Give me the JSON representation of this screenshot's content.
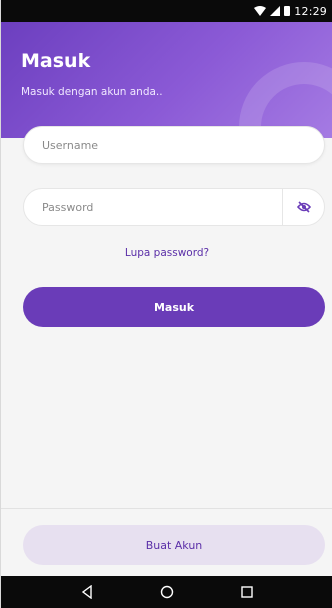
{
  "status_bar": {
    "time": "12:29",
    "icons": [
      "wifi-icon",
      "signal-icon",
      "battery-icon"
    ]
  },
  "header": {
    "title": "Masuk",
    "subtitle": "Masuk dengan akun anda.."
  },
  "form": {
    "username_placeholder": "Username",
    "password_placeholder": "Password",
    "toggle_visibility_icon": "eye-slash-icon",
    "forgot_password": "Lupa password?",
    "submit_label": "Masuk"
  },
  "footer": {
    "create_account_label": "Buat Akun"
  },
  "nav": {
    "icons": [
      "back-icon",
      "home-icon",
      "recents-icon"
    ]
  },
  "colors": {
    "primary": "#6a3cb8",
    "header_gradient_start": "#6c3fbf",
    "header_gradient_end": "#a57be3",
    "secondary_button_bg": "#e7e0f0",
    "link": "#5b2fa8",
    "background": "#f5f5f5"
  }
}
